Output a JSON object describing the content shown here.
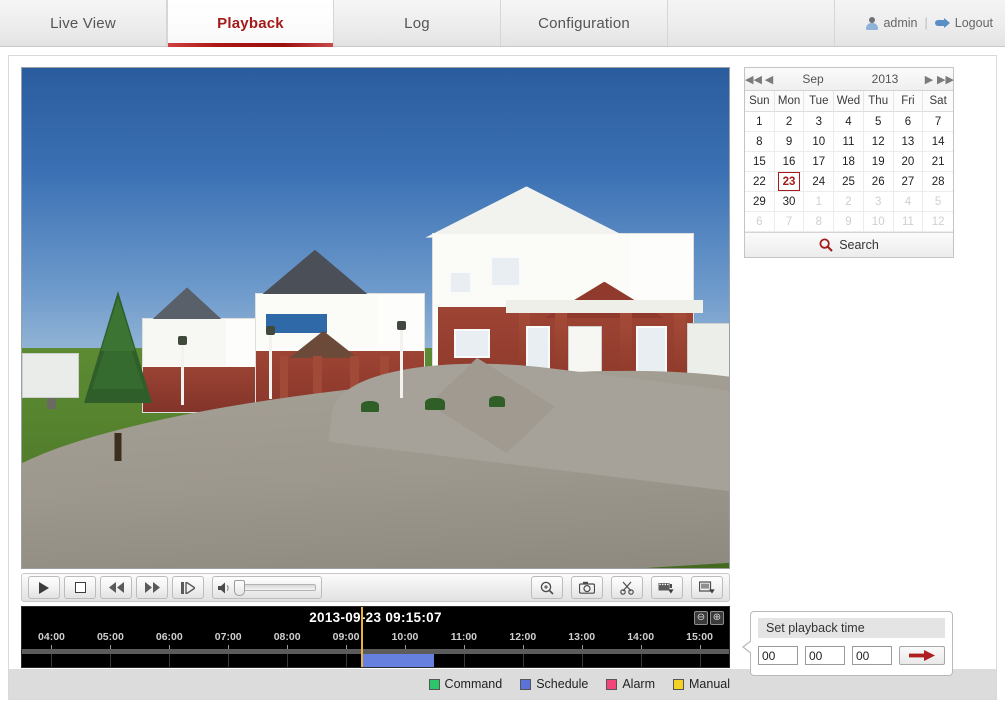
{
  "nav": {
    "tabs": [
      {
        "label": "Live View",
        "active": false
      },
      {
        "label": "Playback",
        "active": true
      },
      {
        "label": "Log",
        "active": false
      },
      {
        "label": "Configuration",
        "active": false
      }
    ],
    "user": {
      "name": "admin",
      "separator": "|",
      "logout": "Logout"
    }
  },
  "controls": {
    "play": "play-button",
    "stop": "stop-button",
    "rewind": "reverse-playback-button",
    "forward": "fast-forward-button",
    "frame": "single-frame-button",
    "volume_value": "10",
    "zoom_in": "digital-zoom-button",
    "capture": "capture-picture-button",
    "clip": "clip-start-button",
    "download_video": "download-video-button",
    "download_picture": "download-picture-button"
  },
  "timeline": {
    "current_time": "2013-09-23 09:15:07",
    "zoom_out_label": "⊖",
    "zoom_in_label": "⊕",
    "ticks": [
      "04:00",
      "05:00",
      "06:00",
      "07:00",
      "08:00",
      "09:00",
      "10:00",
      "11:00",
      "12:00",
      "13:00",
      "14:00",
      "15:00"
    ],
    "cursor_time": "09:15",
    "recordings": [
      {
        "type": "Schedule",
        "start": "09:15",
        "end": "10:30",
        "color": "#6680e0"
      }
    ]
  },
  "legend": [
    {
      "label": "Command",
      "color": "#2ec46a"
    },
    {
      "label": "Schedule",
      "color": "#5b72d8"
    },
    {
      "label": "Alarm",
      "color": "#f0467a"
    },
    {
      "label": "Manual",
      "color": "#f4d224"
    }
  ],
  "calendar": {
    "prev_year": "◀◀",
    "prev_month": "◀",
    "month": "Sep",
    "year": "2013",
    "next_month": "▶",
    "next_year": "▶▶",
    "dow": [
      "Sun",
      "Mon",
      "Tue",
      "Wed",
      "Thu",
      "Fri",
      "Sat"
    ],
    "selected_day": "23",
    "search_label": "Search",
    "weeks": [
      [
        {
          "d": "1",
          "muted": false
        },
        {
          "d": "2",
          "muted": false
        },
        {
          "d": "3",
          "muted": false
        },
        {
          "d": "4",
          "muted": false
        },
        {
          "d": "5",
          "muted": false
        },
        {
          "d": "6",
          "muted": false
        },
        {
          "d": "7",
          "muted": false
        }
      ],
      [
        {
          "d": "8",
          "muted": false
        },
        {
          "d": "9",
          "muted": false
        },
        {
          "d": "10",
          "muted": false
        },
        {
          "d": "11",
          "muted": false
        },
        {
          "d": "12",
          "muted": false
        },
        {
          "d": "13",
          "muted": false
        },
        {
          "d": "14",
          "muted": false
        }
      ],
      [
        {
          "d": "15",
          "muted": false
        },
        {
          "d": "16",
          "muted": false
        },
        {
          "d": "17",
          "muted": false
        },
        {
          "d": "18",
          "muted": false
        },
        {
          "d": "19",
          "muted": false
        },
        {
          "d": "20",
          "muted": false
        },
        {
          "d": "21",
          "muted": false
        }
      ],
      [
        {
          "d": "22",
          "muted": false
        },
        {
          "d": "23",
          "muted": false,
          "selected": true
        },
        {
          "d": "24",
          "muted": false
        },
        {
          "d": "25",
          "muted": false
        },
        {
          "d": "26",
          "muted": false
        },
        {
          "d": "27",
          "muted": false
        },
        {
          "d": "28",
          "muted": false
        }
      ],
      [
        {
          "d": "29",
          "muted": false
        },
        {
          "d": "30",
          "muted": false
        },
        {
          "d": "1",
          "muted": true
        },
        {
          "d": "2",
          "muted": true
        },
        {
          "d": "3",
          "muted": true
        },
        {
          "d": "4",
          "muted": true
        },
        {
          "d": "5",
          "muted": true
        }
      ],
      [
        {
          "d": "6",
          "muted": true
        },
        {
          "d": "7",
          "muted": true
        },
        {
          "d": "8",
          "muted": true
        },
        {
          "d": "9",
          "muted": true
        },
        {
          "d": "10",
          "muted": true
        },
        {
          "d": "11",
          "muted": true
        },
        {
          "d": "12",
          "muted": true
        }
      ]
    ]
  },
  "set_playback": {
    "title": "Set playback time",
    "hour": "00",
    "minute": "00",
    "second": "00",
    "go_label": "go-arrow"
  },
  "colors": {
    "accent_red": "#a51a1a",
    "recording_blue": "#6680e0",
    "cursor": "#e8b33c"
  }
}
